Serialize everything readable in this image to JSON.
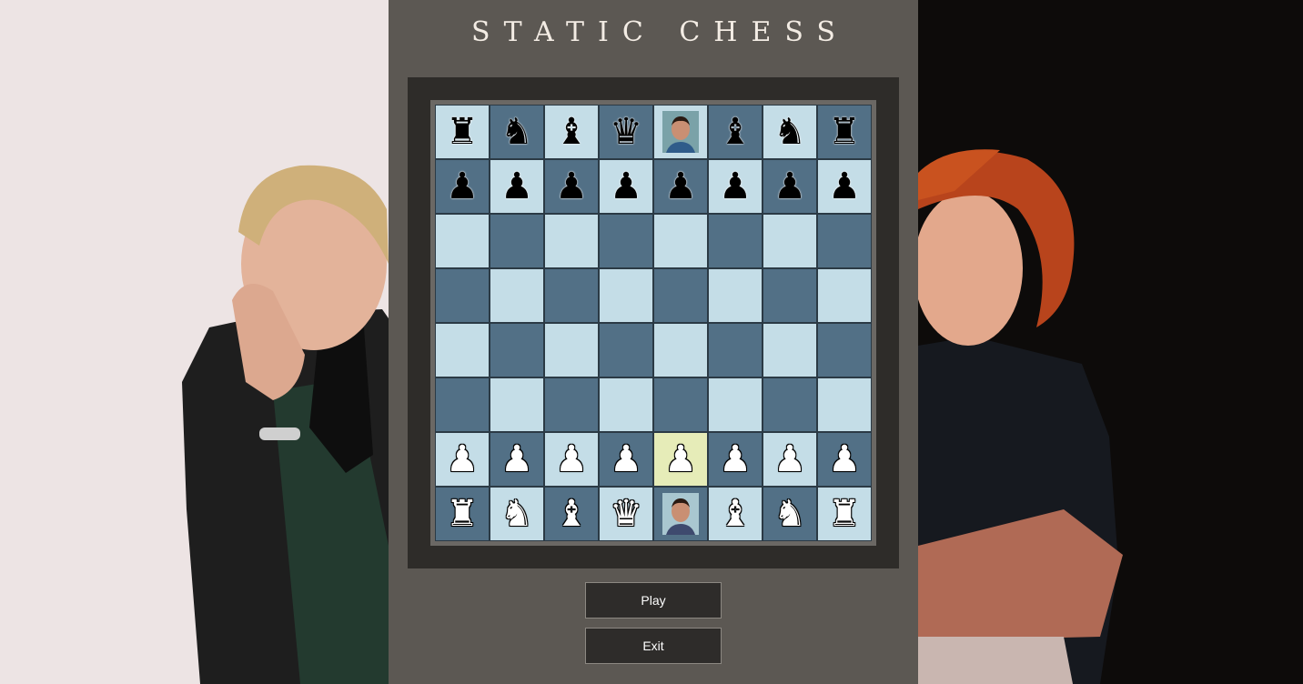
{
  "title": "STATIC CHESS",
  "buttons": {
    "play_label": "Play",
    "exit_label": "Exit"
  },
  "colors": {
    "light_square": "#c4dde7",
    "dark_square": "#527086",
    "highlight": "#e6ecb8",
    "center_panel": "#5c5853"
  },
  "board": {
    "rows": [
      [
        "b-rook",
        "b-knight",
        "b-bishop",
        "b-queen",
        "b-king-face",
        "b-bishop",
        "b-knight",
        "b-rook"
      ],
      [
        "b-pawn",
        "b-pawn",
        "b-pawn",
        "b-pawn",
        "b-pawn",
        "b-pawn",
        "b-pawn",
        "b-pawn"
      ],
      [
        "",
        "",
        "",
        "",
        "",
        "",
        "",
        ""
      ],
      [
        "",
        "",
        "",
        "",
        "",
        "",
        "",
        ""
      ],
      [
        "",
        "",
        "",
        "",
        "",
        "",
        "",
        ""
      ],
      [
        "",
        "",
        "",
        "",
        "",
        "",
        "",
        ""
      ],
      [
        "w-pawn",
        "w-pawn",
        "w-pawn",
        "w-pawn",
        "w-pawn",
        "w-pawn",
        "w-pawn",
        "w-pawn"
      ],
      [
        "w-rook",
        "w-knight",
        "w-bishop",
        "w-queen",
        "w-king-face",
        "w-bishop",
        "w-knight",
        "w-rook"
      ]
    ],
    "highlighted_square": "e2"
  },
  "illustrations": {
    "left": "blonde-man-thinking",
    "right": "red-haired-woman-arms-crossed"
  }
}
